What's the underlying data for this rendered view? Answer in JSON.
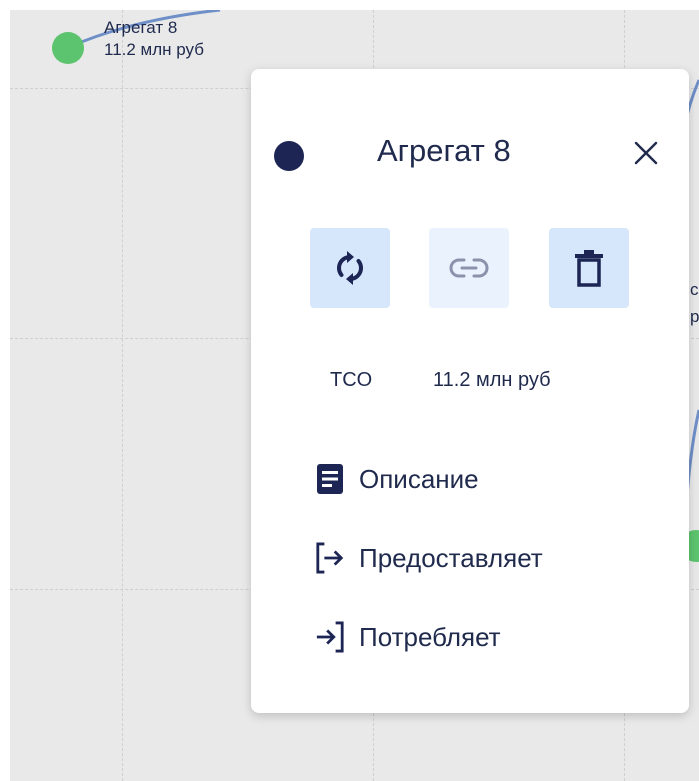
{
  "background_node": {
    "name": "Агрегат 8",
    "value": "11.2 млн руб"
  },
  "side_labels": [
    "с",
    "р"
  ],
  "popup": {
    "title": "Агрегат 8",
    "close_icon": "close-icon",
    "actions": [
      {
        "name": "refresh",
        "icon": "refresh-icon",
        "state": "active"
      },
      {
        "name": "link",
        "icon": "link-icon",
        "state": "disabled"
      },
      {
        "name": "delete",
        "icon": "trash-icon",
        "state": "active"
      }
    ],
    "tco_label": "TCO",
    "tco_value": "11.2 млн руб",
    "menu": [
      {
        "label": "Описание",
        "icon": "description-icon"
      },
      {
        "label": "Предоставляет",
        "icon": "provides-icon"
      },
      {
        "label": "Потребляет",
        "icon": "consumes-icon"
      }
    ]
  },
  "colors": {
    "canvas_background": "#e9e9e9",
    "node_green": "#5cc46e",
    "node_navy": "#1c2554",
    "text": "#1f2a4d",
    "edge_blue": "#6f8fc8",
    "button_active": "#d6e6fb",
    "button_disabled": "#eaf2fd"
  }
}
